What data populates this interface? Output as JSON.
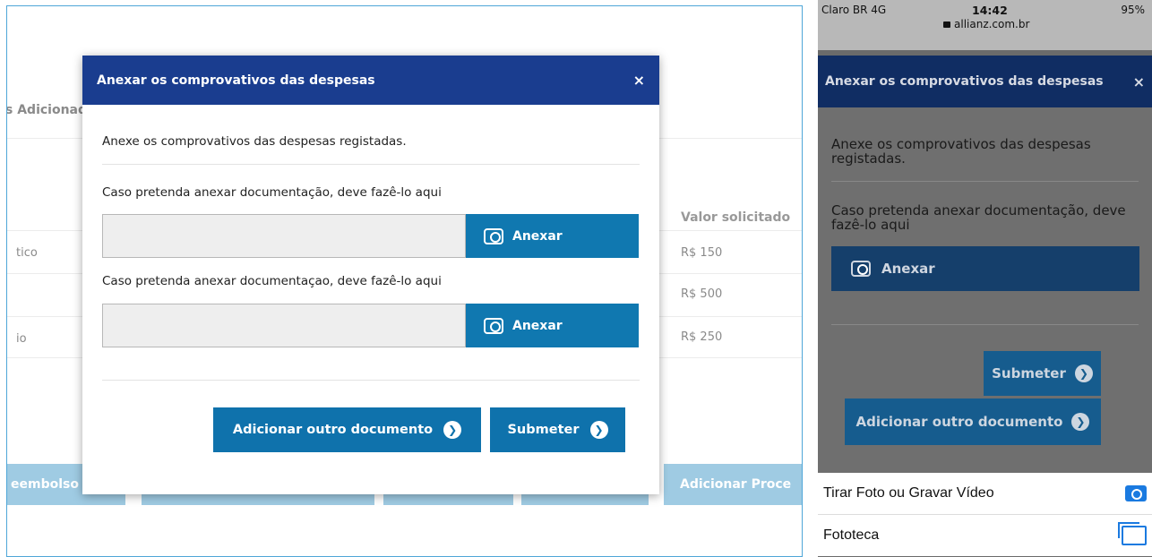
{
  "desktop": {
    "background": {
      "section_heading": "s Adicionad",
      "column_header": "Valor solicitado",
      "row_labels": [
        "tico",
        "",
        "io"
      ],
      "values": [
        "R$ 150",
        "R$ 500",
        "R$ 250"
      ],
      "buttons": [
        "eembolso",
        "",
        "",
        "",
        "Adicionar Proce"
      ]
    },
    "modal": {
      "title": "Anexar os comprovativos das despesas",
      "close": "×",
      "intro": "Anexe os comprovativos das despesas registadas.",
      "label_1": "Caso pretenda anexar documentação, deve fazê-lo aqui",
      "label_2": "Caso pretenda anexar documentaçao, deve fazê-lo aqui",
      "attach_label": "Anexar",
      "add_doc_label": "Adicionar outro documento",
      "submit_label": "Submeter",
      "chevron": "❯"
    },
    "colors": {
      "header": "#1a3d8f",
      "button": "#0f72ac",
      "disabled_button": "#9fcbe3"
    }
  },
  "mobile": {
    "status_bar": {
      "carrier": "Claro BR  4G",
      "time": "14:42",
      "battery": "95%",
      "url": "allianz.com.br"
    },
    "modal": {
      "title": "Anexar os comprovativos das despesas",
      "close": "×",
      "intro": "Anexe os comprovativos das despesas registadas.",
      "label_1": "Caso pretenda anexar documentação, deve fazê-lo aqui",
      "attach_label": "Anexar",
      "submit_label": "Submeter",
      "add_doc_label": "Adicionar outro documento",
      "chevron": "❯"
    },
    "action_sheet": {
      "items": [
        {
          "label": "Tirar Foto ou Gravar Vídeo",
          "icon": "camera-icon"
        },
        {
          "label": "Fototeca",
          "icon": "photo-library-icon"
        }
      ]
    }
  }
}
